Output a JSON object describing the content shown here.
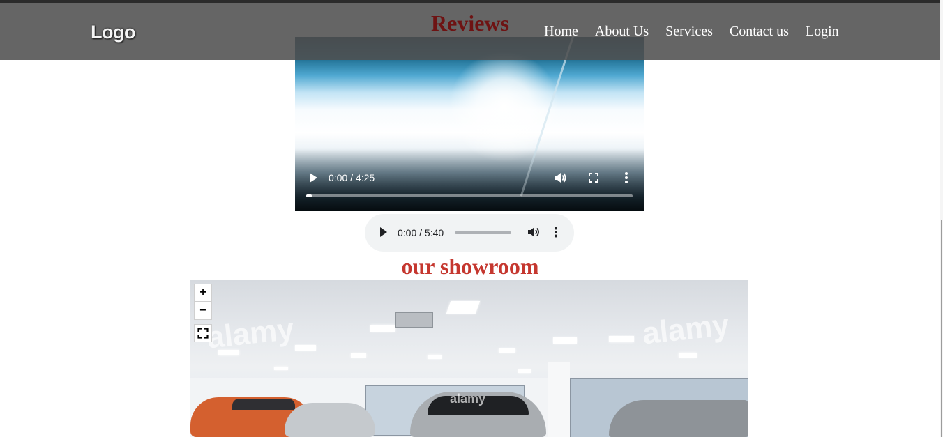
{
  "brand": {
    "logo": "Logo"
  },
  "nav": {
    "items": [
      {
        "label": "Home"
      },
      {
        "label": "About Us"
      },
      {
        "label": "Services"
      },
      {
        "label": "Contact us"
      },
      {
        "label": "Login"
      }
    ]
  },
  "reviews": {
    "title": "Reviews"
  },
  "video": {
    "time": "0:00 / 4:25",
    "progress": 0.0,
    "icons": [
      "play-icon",
      "volume-icon",
      "fullscreen-icon",
      "more-icon"
    ]
  },
  "audio": {
    "time": "0:00 / 5:40",
    "progress": 0.0,
    "icons": [
      "play-icon",
      "volume-icon",
      "more-icon"
    ]
  },
  "showroom": {
    "title": "our showroom",
    "controls": {
      "zoom_in": "+",
      "zoom_out": "−"
    },
    "watermark": "alamy",
    "icons": [
      "fullscreen-icon"
    ]
  },
  "colors": {
    "navbar": "#505050",
    "reviews_title": "#6e1313",
    "showroom_title": "#c5372f",
    "audio_bg": "#f1f3f4"
  }
}
